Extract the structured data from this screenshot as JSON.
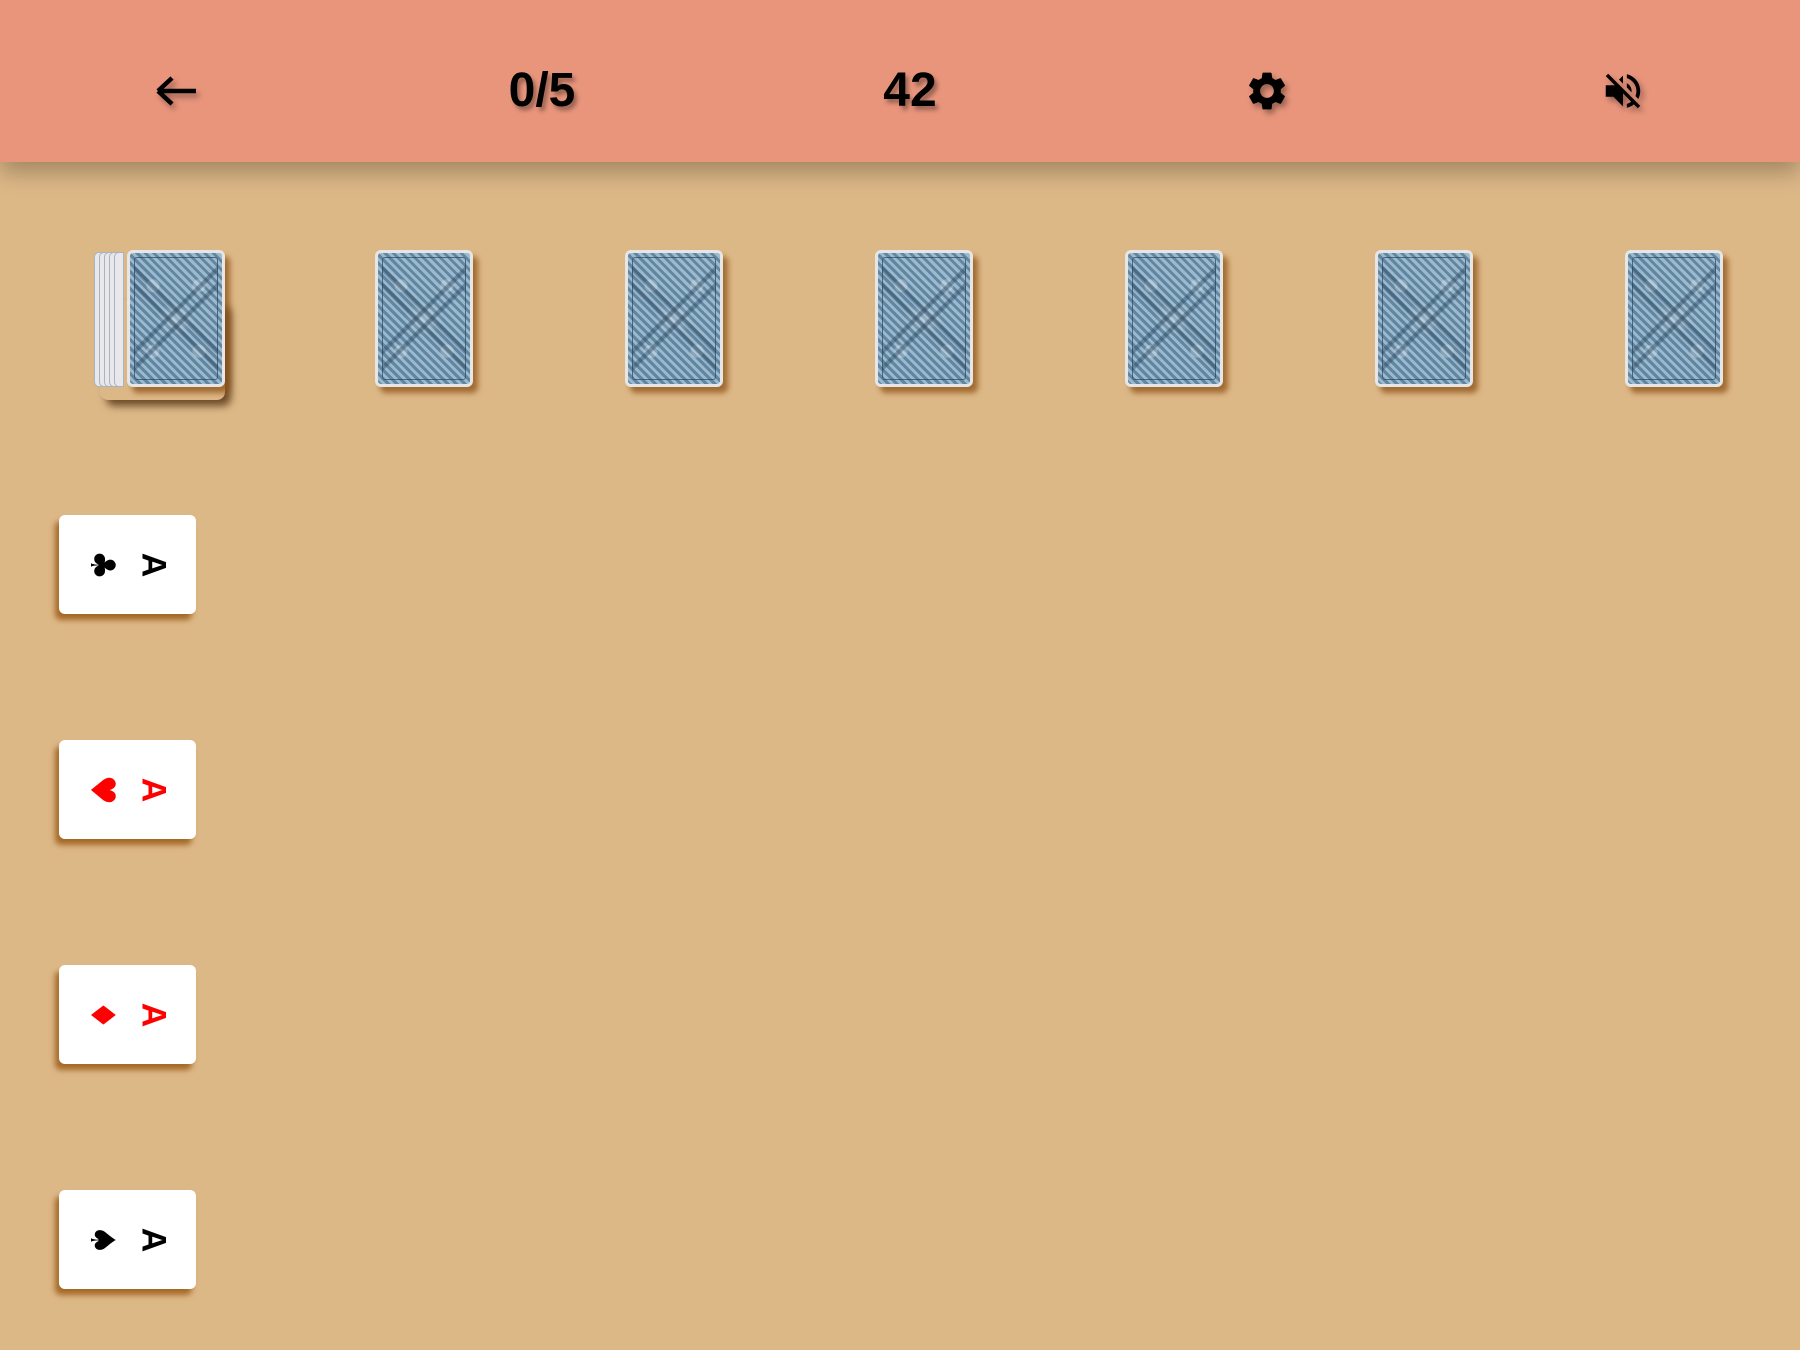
{
  "header": {
    "back_icon": "arrow-left-icon",
    "progress": "0/5",
    "score": "42",
    "settings_icon": "gear-icon",
    "sound_icon": "volume-mute-icon"
  },
  "colors": {
    "header_bg": "#e9957c",
    "table_bg": "#ddb887",
    "card_back": "#6f93ad",
    "red_suit": "#ff0000",
    "black_suit": "#000000"
  },
  "stock": {
    "icon": "card-back",
    "face_down": true
  },
  "columns": [
    {
      "face_down": true
    },
    {
      "face_down": true
    },
    {
      "face_down": true
    },
    {
      "face_down": true
    },
    {
      "face_down": true
    },
    {
      "face_down": true
    }
  ],
  "foundations": [
    {
      "rank": "A",
      "suit": "♣",
      "suit_name": "clubs",
      "color": "#000000"
    },
    {
      "rank": "A",
      "suit": "♥",
      "suit_name": "hearts",
      "color": "#ff0000"
    },
    {
      "rank": "A",
      "suit": "♦",
      "suit_name": "diamonds",
      "color": "#ff0000"
    },
    {
      "rank": "A",
      "suit": "♠",
      "suit_name": "spades",
      "color": "#000000"
    }
  ]
}
